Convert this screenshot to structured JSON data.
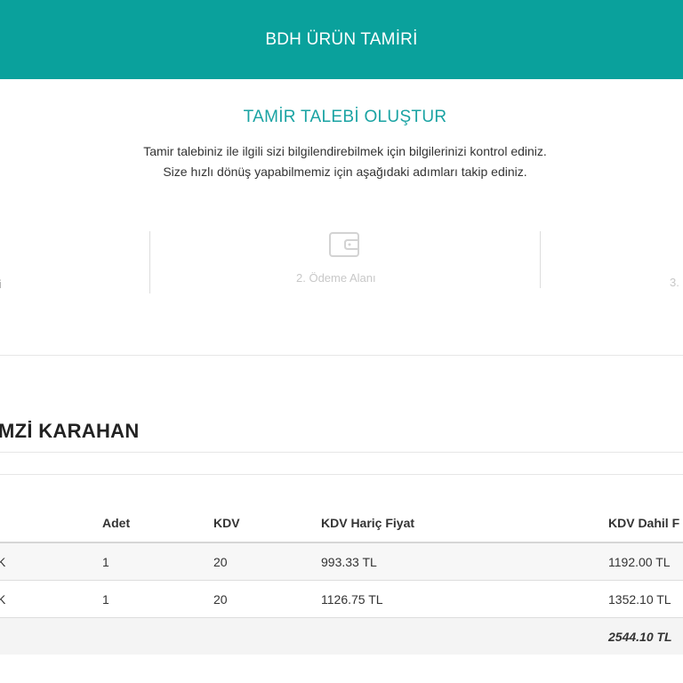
{
  "header": {
    "title": "BDH ÜRÜN TAMİRİ"
  },
  "page": {
    "heading": "TAMİR TALEBİ OLUŞTUR",
    "intro_line1": "Tamir talebiniz ile ilgili sizi bilgilendirebilmek için bilgilerinizi kontrol ediniz.",
    "intro_line2": "Size hızlı dönüş yapabilmemiz için aşağıdaki adımları takip ediniz."
  },
  "steps": [
    {
      "label": "ri"
    },
    {
      "label": "2. Ödeme Alanı",
      "icon": "wallet-icon"
    },
    {
      "label": "3."
    }
  ],
  "customer": {
    "name": "MZİ KARAHAN"
  },
  "table": {
    "headers": [
      "Adet",
      "KDV",
      "KDV Hariç Fiyat",
      "KDV Dahil F"
    ],
    "rows": [
      {
        "name": "K",
        "qty": "1",
        "vat": "20",
        "price_ex": "993.33 TL",
        "price_inc": "1192.00 TL"
      },
      {
        "name": "K",
        "qty": "1",
        "vat": "20",
        "price_ex": "1126.75 TL",
        "price_inc": "1352.10 TL"
      }
    ],
    "total": "2544.10 TL"
  },
  "colors": {
    "header_bg": "#0aa19c",
    "heading_color": "#1aa3a3"
  }
}
